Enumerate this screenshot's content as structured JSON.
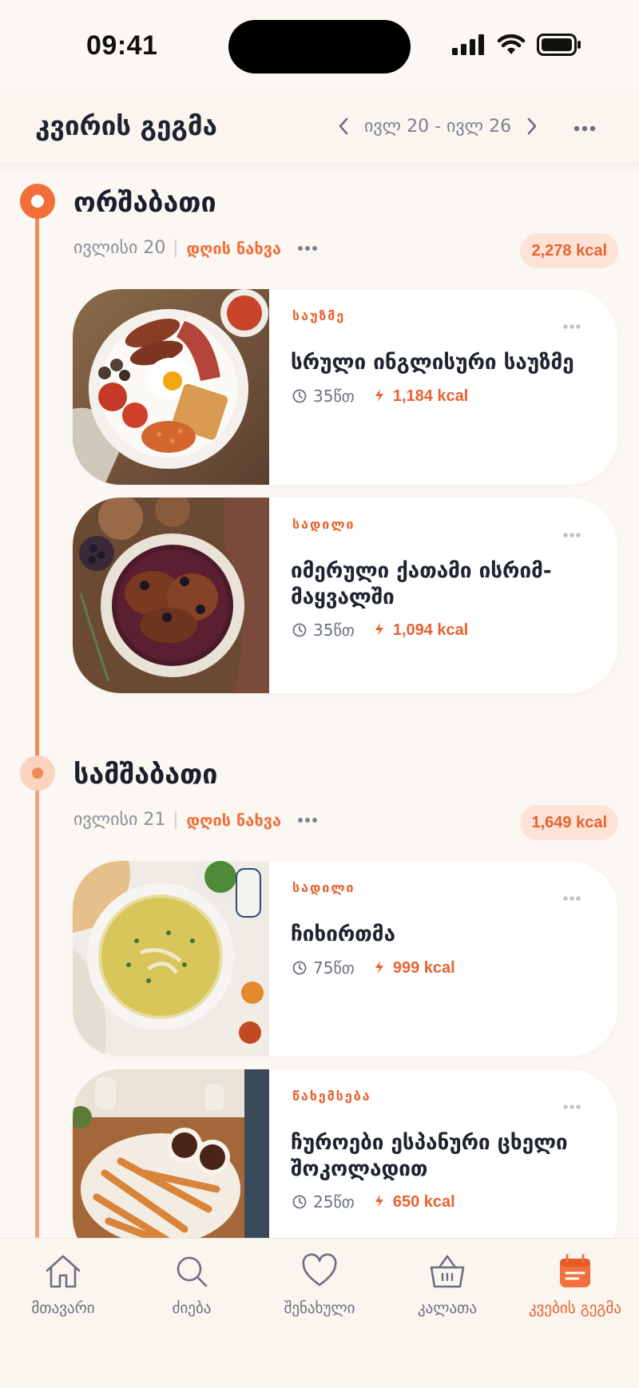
{
  "status_bar": {
    "time": "09:41"
  },
  "header": {
    "title": "კვირის გეგმა",
    "week_range": "ივლ 20 - ივლ 26"
  },
  "days": [
    {
      "name": "ორშაბათი",
      "date": "ივლისი 20",
      "view_label": "დღის ნახვა",
      "kcal": "2,278 kcal",
      "meals": [
        {
          "category": "საუზმე",
          "title": "სრული ინგლისური საუზმე",
          "time": "35წთ",
          "kcal": "1,184 kcal"
        },
        {
          "category": "სადილი",
          "title": "იმერული ქათამი ისრიმ-მაყვალში",
          "time": "35წთ",
          "kcal": "1,094 kcal"
        }
      ]
    },
    {
      "name": "სამშაბათი",
      "date": "ივლისი 21",
      "view_label": "დღის ნახვა",
      "kcal": "1,649 kcal",
      "meals": [
        {
          "category": "სადილი",
          "title": "ჩიხირთმა",
          "time": "75წთ",
          "kcal": "999 kcal"
        },
        {
          "category": "წახემსება",
          "title": "ჩუროები ესპანური ცხელი შოკოლადით",
          "time": "25წთ",
          "kcal": "650 kcal"
        }
      ]
    }
  ],
  "bottom_nav": [
    {
      "label": "მთავარი",
      "icon": "home-icon",
      "active": false
    },
    {
      "label": "ძიება",
      "icon": "search-icon",
      "active": false
    },
    {
      "label": "შენახული",
      "icon": "heart-icon",
      "active": false
    },
    {
      "label": "კალათა",
      "icon": "basket-icon",
      "active": false
    },
    {
      "label": "კვების გეგმა",
      "icon": "calendar-icon",
      "active": true
    }
  ],
  "colors": {
    "accent": "#f26f3a",
    "background": "#fbf7f2",
    "card": "#ffffff",
    "badge_bg": "#fde3d6"
  }
}
